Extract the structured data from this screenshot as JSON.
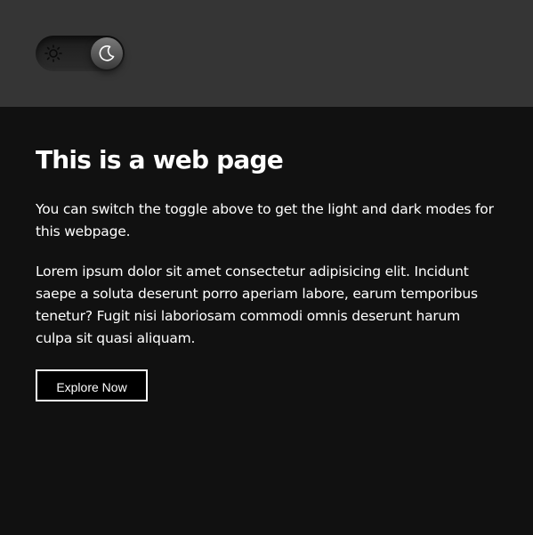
{
  "header": {
    "theme_toggle": {
      "left_icon": "sun-icon",
      "right_icon": "moon-icon",
      "state": "dark"
    }
  },
  "main": {
    "title": "This is a web page",
    "intro": "You can switch the toggle above to get the light and dark modes for this webpage.",
    "body": "Lorem ipsum dolor sit amet consectetur adipisicing elit. Incidunt saepe a soluta deserunt porro aperiam labore, earum temporibus tenetur? Fugit nisi laboriosam commodi omnis deserunt harum culpa sit quasi aliquam.",
    "cta_label": "Explore Now"
  },
  "colors": {
    "header_bg": "#353535",
    "page_bg": "#111111",
    "text": "#ffffff",
    "button_bg": "#000000"
  }
}
